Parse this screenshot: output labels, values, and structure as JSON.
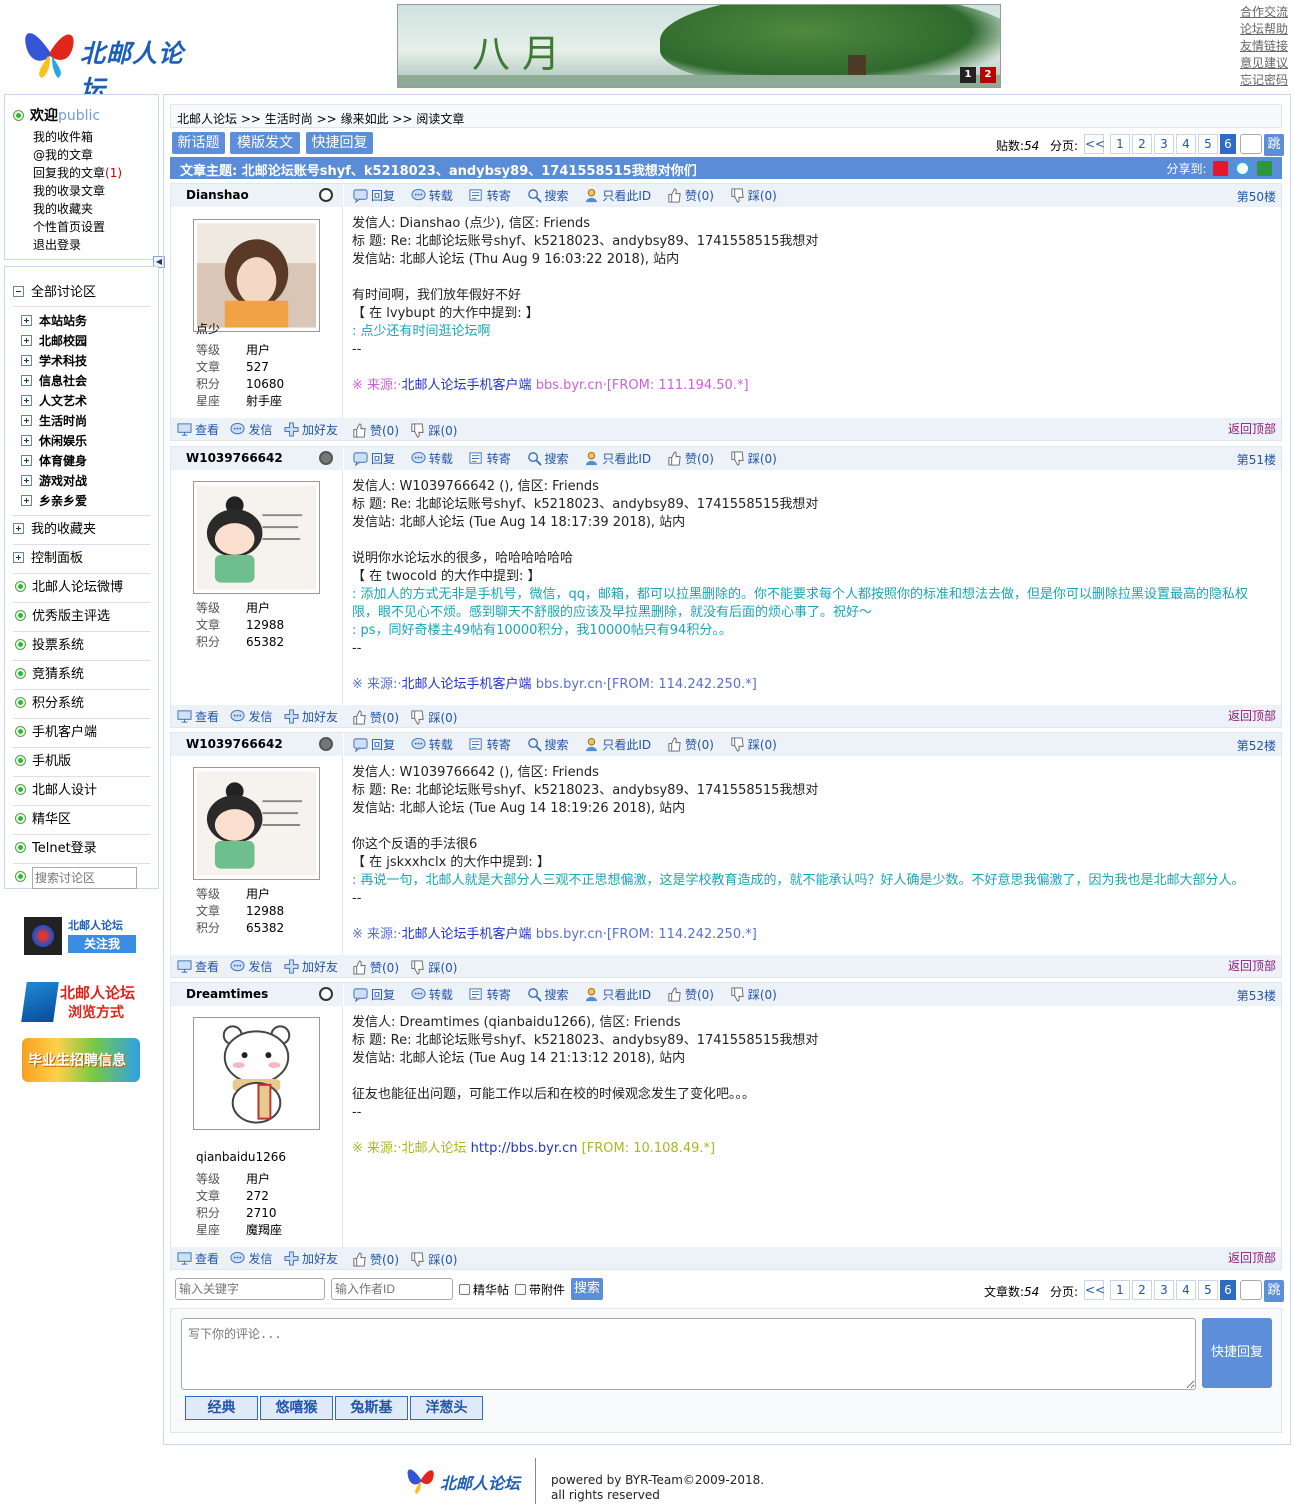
{
  "header": {
    "logo_text": "北邮人论坛",
    "banner_text": "八月",
    "banner_pages": [
      "1",
      "2"
    ],
    "top_links": [
      "合作交流",
      "论坛帮助",
      "友情链接",
      "意见建议",
      "忘记密码"
    ]
  },
  "user": {
    "welcome": "欢迎",
    "name": "public",
    "links": [
      "我的收件箱",
      "@我的文章",
      "回复我的文章",
      "我的收录文章",
      "我的收藏夹",
      "个性首页设置",
      "退出登录"
    ],
    "reply_count": "(1)"
  },
  "nav": {
    "all_sections": "全部讨论区",
    "sections": [
      "本站站务",
      "北邮校园",
      "学术科技",
      "信息社会",
      "人文艺术",
      "生活时尚",
      "休闲娱乐",
      "体育健身",
      "游戏对战",
      "乡亲乡爱"
    ],
    "folders": [
      "我的收藏夹",
      "控制面板"
    ],
    "items": [
      "北邮人论坛微博",
      "优秀版主评选",
      "投票系统",
      "竞猜系统",
      "积分系统",
      "手机客户端",
      "手机版",
      "北邮人设计",
      "精华区",
      "Telnet登录"
    ],
    "search_placeholder": "搜索讨论区",
    "promo_weibo_1": "北邮人论坛",
    "promo_weibo_2": "关注我",
    "promo_browse_1": "北邮人论坛",
    "promo_browse_2": "浏览方式",
    "promo_job": "毕业生招聘信息"
  },
  "breadcrumb": [
    "北邮人论坛",
    ">>",
    "生活时尚",
    ">>",
    "缘来如此",
    ">>",
    "阅读文章"
  ],
  "toolbar": {
    "new_topic": "新话题",
    "template_post": "模版发文",
    "quick_reply": "快捷回复"
  },
  "pager_top": {
    "count_label": "贴数:",
    "count": "54",
    "page_label": "分页:",
    "prev": "<<",
    "pages": [
      "1",
      "2",
      "3",
      "4",
      "5",
      "6"
    ],
    "current": "6",
    "go": "跳"
  },
  "subject": {
    "label": "文章主题:",
    "title": "北邮论坛账号shyf、k5218023、andybsy89、1741558515我想对你们",
    "share_label": "分享到:"
  },
  "actions": {
    "reply": "回复",
    "forward": "转载",
    "mail": "转寄",
    "search": "搜索",
    "only_id": "只看此ID",
    "like": "赞(0)",
    "dislike": "踩(0)",
    "view": "查看",
    "send": "发信",
    "add_friend": "加好友",
    "back_top": "返回顶部"
  },
  "stat_labels": {
    "level": "等级",
    "posts": "文章",
    "points": "积分",
    "star": "星座"
  },
  "posts": [
    {
      "user": "Dianshao",
      "nick": "点少",
      "level": "用户",
      "posts": "527",
      "points": "10680",
      "star": "射手座",
      "floor": "第50楼",
      "lines": [
        "发信人: Dianshao (点少), 信区: Friends",
        "标  题: Re: 北邮论坛账号shyf、k5218023、andybsy89、1741558515我想对",
        "发信站: 北邮人论坛 (Thu Aug  9 16:03:22 2018), 站内",
        "",
        "有时间啊，我们放年假好不好",
        "【 在 lvybupt 的大作中提到: 】"
      ],
      "quotes": [
        ": 点少还有时间逛论坛啊"
      ],
      "sep": "--",
      "src_prefix": "※ 来源:·",
      "src_link": "北邮人论坛手机客户端",
      "src_suffix": " bbs.byr.cn·[FROM: 111.194.50.*]"
    },
    {
      "user": "W1039766642",
      "nick": "",
      "level": "用户",
      "posts": "12988",
      "points": "65382",
      "floor": "第51楼",
      "lines": [
        "发信人: W1039766642 (), 信区: Friends",
        "标  题: Re: 北邮论坛账号shyf、k5218023、andybsy89、1741558515我想对",
        "发信站: 北邮人论坛 (Tue Aug 14 18:17:39 2018), 站内",
        "",
        "说明你水论坛水的很多，哈哈哈哈哈哈",
        "【 在 twocold 的大作中提到: 】"
      ],
      "quotes": [
        ": 添加人的方式无非是手机号，微信，qq，邮箱，都可以拉黑删除的。你不能要求每个人都按照你的标准和想法去做，但是你可以删除拉黑设置最高的隐私权限，眼不见心不烦。感到聊天不舒服的应该及早拉黑删除，就没有后面的烦心事了。祝好～",
        ": ps，同好奇楼主49帖有10000积分，我10000帖只有94积分。。"
      ],
      "sep": "--",
      "src_prefix": "※ 来源:·",
      "src_link": "北邮人论坛手机客户端",
      "src_suffix": " bbs.byr.cn·[FROM: 114.242.250.*]"
    },
    {
      "user": "W1039766642",
      "nick": "",
      "level": "用户",
      "posts": "12988",
      "points": "65382",
      "floor": "第52楼",
      "lines": [
        "发信人: W1039766642 (), 信区: Friends",
        "标  题: Re: 北邮论坛账号shyf、k5218023、andybsy89、1741558515我想对",
        "发信站: 北邮人论坛 (Tue Aug 14 18:19:26 2018), 站内",
        "",
        "你这个反语的手法很6",
        "【 在 jskxxhclx 的大作中提到: 】"
      ],
      "quotes": [
        ": 再说一句，北邮人就是大部分人三观不正思想偏激，这是学校教育造成的，就不能承认吗？好人确是少数。不好意思我偏激了，因为我也是北邮大部分人。"
      ],
      "sep": "--",
      "src_prefix": "※ 来源:·",
      "src_link": "北邮人论坛手机客户端",
      "src_suffix": " bbs.byr.cn·[FROM: 114.242.250.*]"
    },
    {
      "user": "Dreamtimes",
      "nick": "qianbaidu1266",
      "level": "用户",
      "posts": "272",
      "points": "2710",
      "star": "魔羯座",
      "floor": "第53楼",
      "lines": [
        "发信人: Dreamtimes (qianbaidu1266), 信区: Friends",
        "标  题: Re: 北邮论坛账号shyf、k5218023、andybsy89、1741558515我想对",
        "发信站: 北邮人论坛 (Tue Aug 14 21:13:12 2018), 站内",
        "",
        "征友也能征出问题，可能工作以后和在校的时候观念发生了变化吧。。。"
      ],
      "quotes": [],
      "sep": "--",
      "src_prefix": "※ 来源:·北邮人论坛 ",
      "src_link": "http://bbs.byr.cn",
      "src_suffix": " [FROM: 10.108.49.*]"
    }
  ],
  "filter": {
    "keyword_placeholder": "输入关键字",
    "author_placeholder": "输入作者ID",
    "digest": "精华帖",
    "attachment": "带附件",
    "search": "搜索"
  },
  "pager_bottom": {
    "count_label": "文章数:",
    "count": "54",
    "page_label": "分页:"
  },
  "reply": {
    "placeholder": "写下你的评论...",
    "button": "快捷回复",
    "emotions": [
      "经典",
      "悠嘻猴",
      "兔斯基",
      "洋葱头"
    ]
  },
  "footer": {
    "logo_text": "北邮人论坛",
    "powered": "powered by BYR-Team©2009-2018.",
    "rights": "all rights reserved"
  },
  "colors": {
    "accent": "#5a8cd8",
    "light_bar": "#edf2f8",
    "quote": "#1aa5b5",
    "back_top": "#8b1a7a"
  }
}
